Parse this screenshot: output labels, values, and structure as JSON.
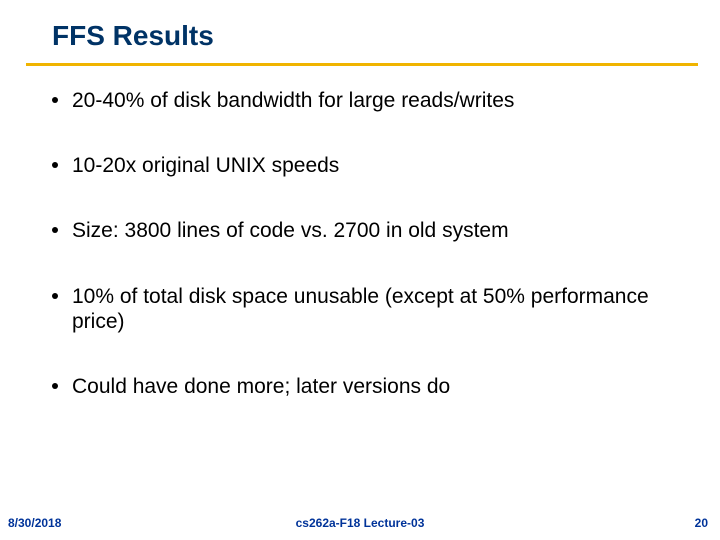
{
  "title": "FFS Results",
  "bullets": [
    "20-40% of disk bandwidth for large reads/writes",
    "10-20x original UNIX speeds",
    "Size: 3800 lines of code vs. 2700 in old system",
    "10% of total disk space unusable (except at 50% performance price)",
    "Could have done more; later versions do"
  ],
  "footer": {
    "date": "8/30/2018",
    "course": "cs262a-F18 Lecture-03",
    "page": "20"
  }
}
